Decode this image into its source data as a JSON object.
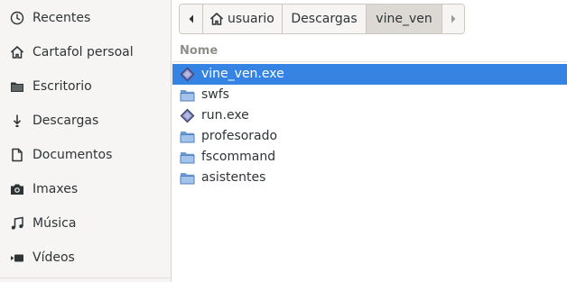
{
  "sidebar": {
    "items": [
      {
        "label": "Recentes",
        "icon": "clock-icon"
      },
      {
        "label": "Cartafol persoal",
        "icon": "home-icon"
      },
      {
        "label": "Escritorio",
        "icon": "folder-icon"
      },
      {
        "label": "Descargas",
        "icon": "download-icon"
      },
      {
        "label": "Documentos",
        "icon": "document-icon"
      },
      {
        "label": "Imaxes",
        "icon": "camera-icon"
      },
      {
        "label": "Música",
        "icon": "music-icon"
      },
      {
        "label": "Vídeos",
        "icon": "video-icon"
      }
    ]
  },
  "pathbar": {
    "back_icon": "chevron-left-icon",
    "forward_icon": "chevron-right-icon",
    "segments": [
      {
        "label": "usuario",
        "icon": "home-icon"
      },
      {
        "label": "Descargas"
      },
      {
        "label": "vine_ven",
        "active": true
      }
    ]
  },
  "filelist": {
    "column_name": "Nome",
    "files": [
      {
        "name": "vine_ven.exe",
        "icon": "executable-icon",
        "selected": true
      },
      {
        "name": "swfs",
        "icon": "folder-icon"
      },
      {
        "name": "run.exe",
        "icon": "executable-icon"
      },
      {
        "name": "profesorado",
        "icon": "folder-icon"
      },
      {
        "name": "fscommand",
        "icon": "folder-icon"
      },
      {
        "name": "asistentes",
        "icon": "folder-icon"
      }
    ]
  },
  "colors": {
    "selection": "#3584e4",
    "sidebar_bg": "#f6f5f4",
    "folder": "#6f9bd1"
  }
}
